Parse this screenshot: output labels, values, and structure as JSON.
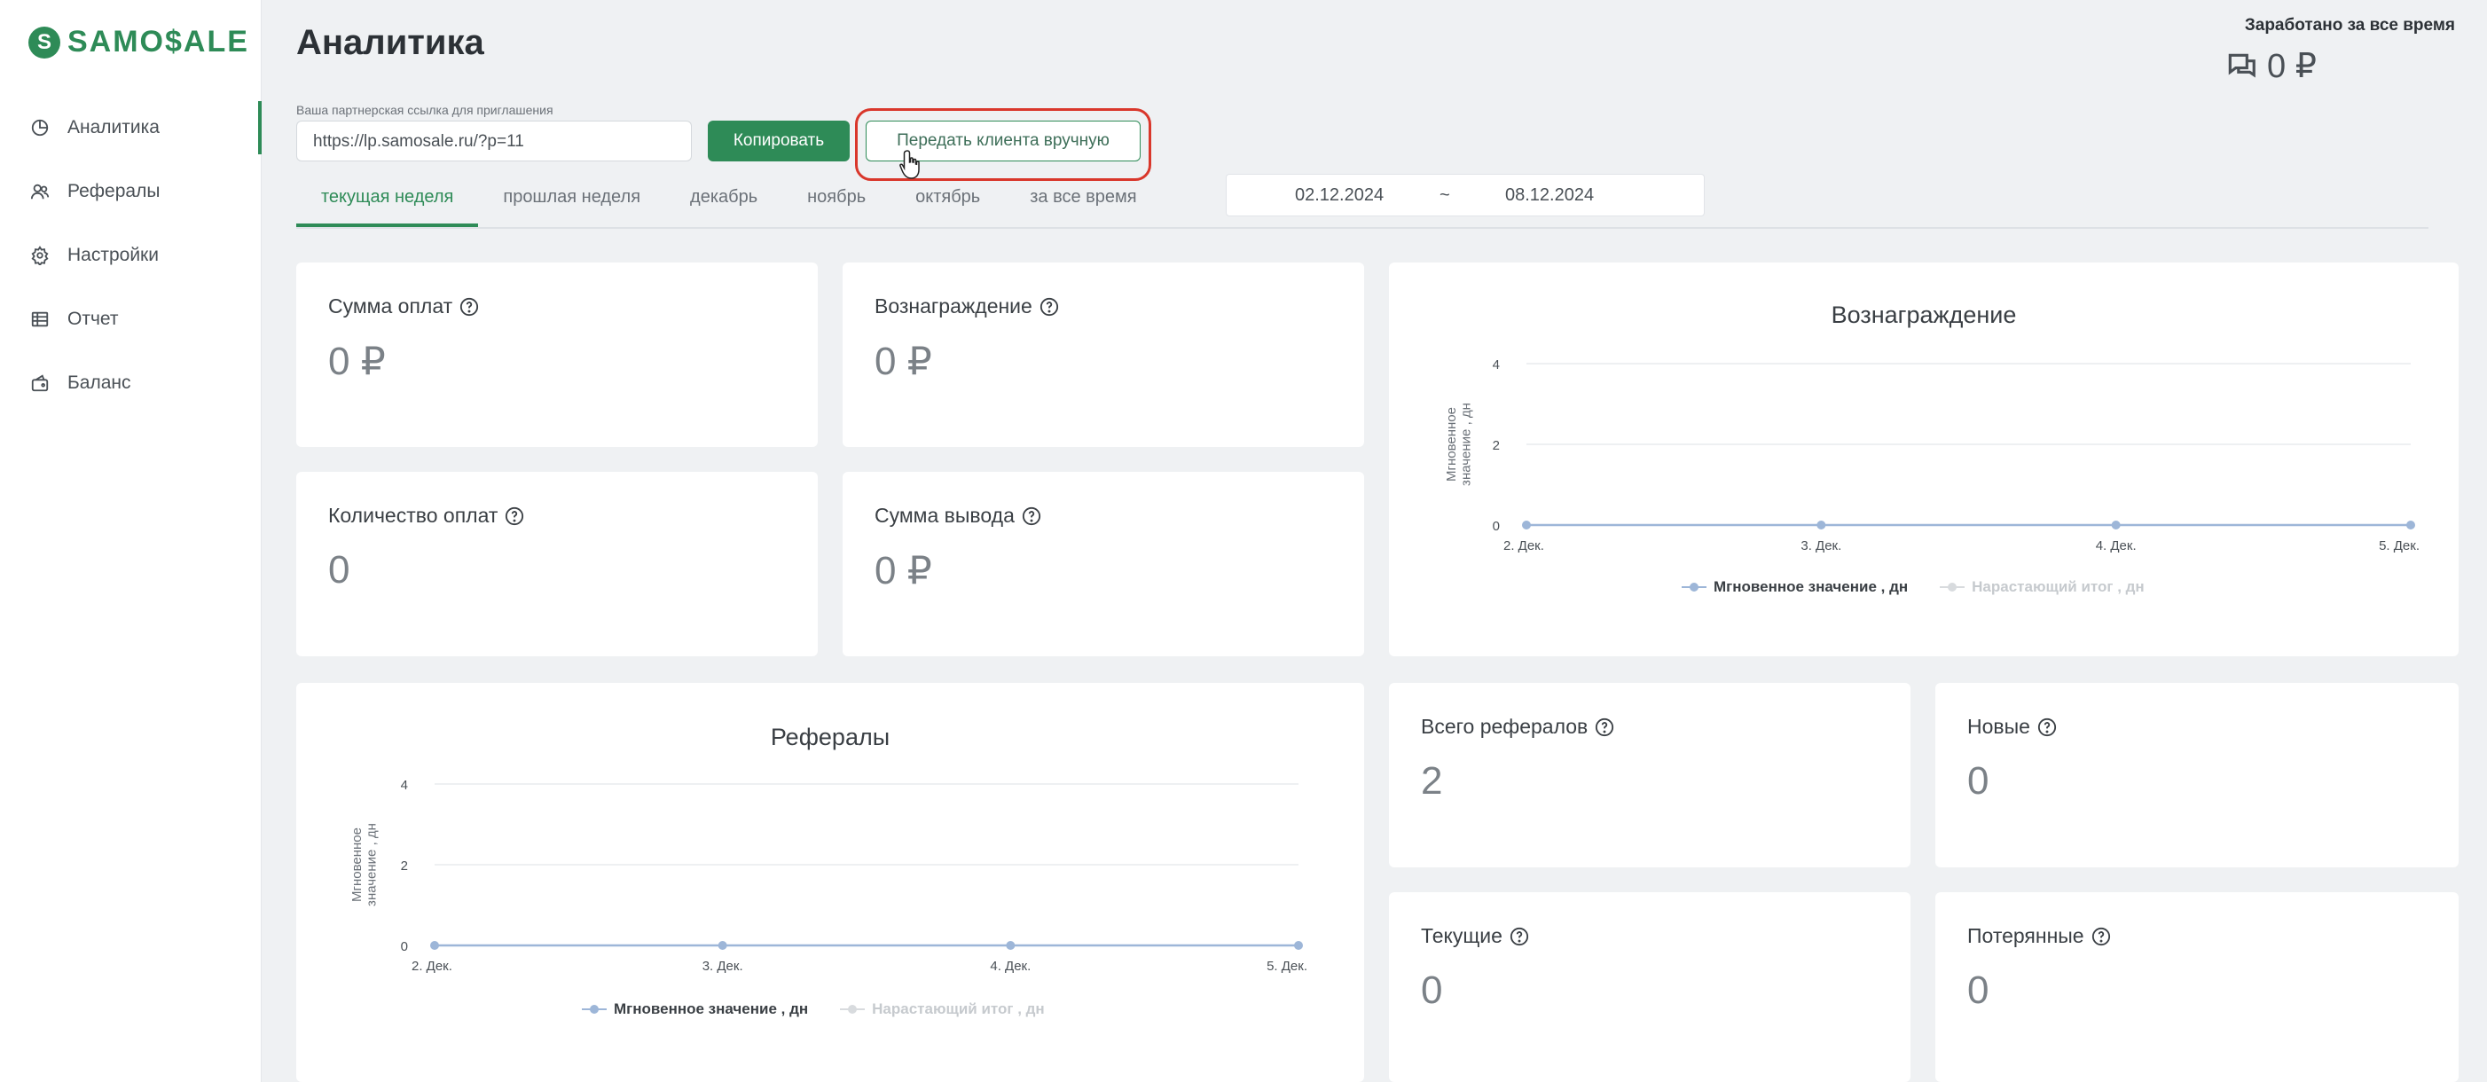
{
  "brand": {
    "logo_symbol": "S",
    "name": "SAMO$ALE",
    "color": "#2e8b57"
  },
  "sidebar": {
    "items": [
      {
        "label": "Аналитика",
        "icon": "pie-chart-icon",
        "active": true
      },
      {
        "label": "Рефералы",
        "icon": "users-icon",
        "active": false
      },
      {
        "label": "Настройки",
        "icon": "gear-icon",
        "active": false
      },
      {
        "label": "Отчет",
        "icon": "table-icon",
        "active": false
      },
      {
        "label": "Баланс",
        "icon": "wallet-icon",
        "active": false
      }
    ]
  },
  "header": {
    "title": "Аналитика",
    "invite_label": "Ваша партнерская ссылка для приглашения",
    "invite_link": "https://lp.samosale.ru/?p=11",
    "copy_button": "Копировать",
    "transfer_button": "Передать клиента вручную"
  },
  "earned": {
    "label": "Заработано за все время",
    "value": "0 ₽",
    "icon": "chat-icon"
  },
  "tabs": [
    {
      "label": "текущая неделя",
      "active": true
    },
    {
      "label": "прошлая неделя",
      "active": false
    },
    {
      "label": "декабрь",
      "active": false
    },
    {
      "label": "ноябрь",
      "active": false
    },
    {
      "label": "октябрь",
      "active": false
    },
    {
      "label": "за все время",
      "active": false
    }
  ],
  "date_range": {
    "from": "02.12.2024",
    "separator": "~",
    "to": "08.12.2024"
  },
  "cards": {
    "sum_payments": {
      "label": "Сумма оплат",
      "value": "0 ₽"
    },
    "reward": {
      "label": "Вознаграждение",
      "value": "0 ₽"
    },
    "count_payments": {
      "label": "Количество оплат",
      "value": "0"
    },
    "sum_withdraw": {
      "label": "Сумма вывода",
      "value": "0 ₽"
    },
    "total_referrals": {
      "label": "Всего рефералов",
      "value": "2"
    },
    "new": {
      "label": "Новые",
      "value": "0"
    },
    "current": {
      "label": "Текущие",
      "value": "0"
    },
    "lost": {
      "label": "Потерянные",
      "value": "0"
    }
  },
  "chart_data": [
    {
      "type": "line",
      "title": "Вознаграждение",
      "ylabel": "Мгновенное значение , дн",
      "categories": [
        "2. Дек.",
        "3. Дек.",
        "4. Дек.",
        "5. Дек."
      ],
      "yticks": [
        0,
        2,
        4
      ],
      "ylim": [
        0,
        4
      ],
      "series": [
        {
          "name": "Мгновенное значение , дн",
          "values": [
            0,
            0,
            0,
            0
          ],
          "color": "#9db6d8",
          "visible": true
        },
        {
          "name": "Нарастающий итог , дн",
          "values": [
            0,
            0,
            0,
            0
          ],
          "color": "#d8dbde",
          "visible": false
        }
      ]
    },
    {
      "type": "line",
      "title": "Рефералы",
      "ylabel": "Мгновенное значение , дн",
      "categories": [
        "2. Дек.",
        "3. Дек.",
        "4. Дек.",
        "5. Дек."
      ],
      "yticks": [
        0,
        2,
        4
      ],
      "ylim": [
        0,
        4
      ],
      "series": [
        {
          "name": "Мгновенное значение , дн",
          "values": [
            0,
            0,
            0,
            0
          ],
          "color": "#9db6d8",
          "visible": true
        },
        {
          "name": "Нарастающий итог , дн",
          "values": [
            0,
            0,
            0,
            0
          ],
          "color": "#d8dbde",
          "visible": false
        }
      ]
    }
  ]
}
